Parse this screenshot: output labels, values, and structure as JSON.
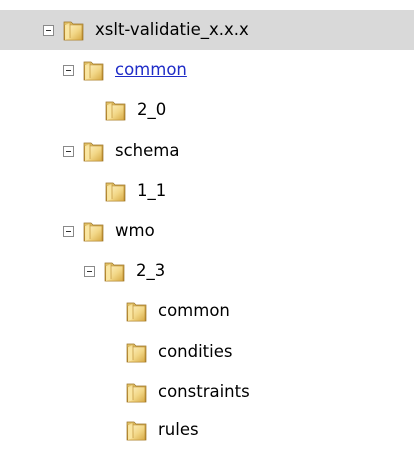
{
  "tree": {
    "root": {
      "label": "xslt-validatie_x.x.x"
    },
    "common": {
      "label": "common"
    },
    "common_2_0": {
      "label": "2_0"
    },
    "schema": {
      "label": "schema"
    },
    "schema_1_1": {
      "label": "1_1"
    },
    "wmo": {
      "label": "wmo"
    },
    "wmo_2_3": {
      "label": "2_3"
    },
    "wmo_2_3_common": {
      "label": "common"
    },
    "wmo_2_3_condities": {
      "label": "condities"
    },
    "wmo_2_3_constraints": {
      "label": "constraints"
    },
    "wmo_2_3_rules": {
      "label": "rules"
    }
  },
  "colors": {
    "selected_background": "#d9d9d9",
    "link": "#1f2cc7",
    "folder_light": "#f7df8c",
    "folder_dark": "#c69c3b"
  }
}
